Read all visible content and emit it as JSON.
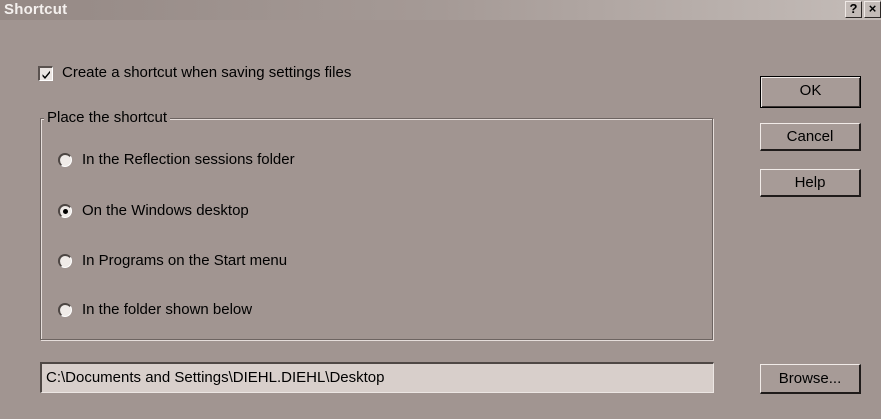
{
  "window": {
    "title": "Shortcut",
    "help_glyph": "?",
    "close_glyph": "×"
  },
  "checkbox": {
    "label": "Create a shortcut when saving settings files",
    "checked": true
  },
  "group": {
    "label": "Place the shortcut",
    "options": [
      {
        "label": "In the Reflection sessions folder",
        "selected": false
      },
      {
        "label": "On the Windows desktop",
        "selected": true
      },
      {
        "label": "In Programs on the Start menu",
        "selected": false
      },
      {
        "label": "In the folder shown below",
        "selected": false
      }
    ]
  },
  "path": {
    "value": "C:\\Documents and Settings\\DIEHL.DIEHL\\Desktop"
  },
  "buttons": {
    "ok": "OK",
    "cancel": "Cancel",
    "help": "Help",
    "browse": "Browse..."
  },
  "colors": {
    "dialog_bg": "#a19591",
    "titlebar": "#958985",
    "input_bg": "#d8cfcb"
  }
}
